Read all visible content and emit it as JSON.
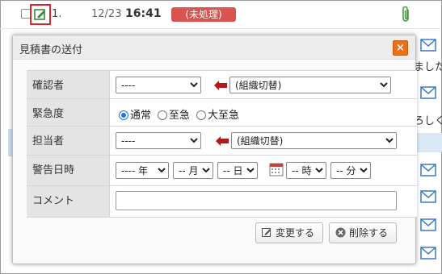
{
  "list_row": {
    "number": "1.",
    "date": "12/23",
    "time": "16:41",
    "status_badge": "(未処理)"
  },
  "side_texts": [
    "ました",
    "ろしく"
  ],
  "dialog": {
    "title": "見積書の送付",
    "close_label": "×",
    "rows": {
      "confirmer": {
        "label": "確認者",
        "user_value": "----",
        "org_value": "(組織切替)"
      },
      "urgency": {
        "label": "緊急度",
        "options": [
          "通常",
          "至急",
          "大至急"
        ],
        "selected": "通常"
      },
      "assignee": {
        "label": "担当者",
        "user_value": "----",
        "org_value": "(組織切替)"
      },
      "alert_date": {
        "label": "警告日時",
        "year": "---- 年",
        "month": "-- 月",
        "day": "-- 日",
        "hour": "-- 時",
        "minute": "-- 分"
      },
      "comment": {
        "label": "コメント",
        "value": ""
      }
    },
    "buttons": {
      "change": "変更する",
      "delete": "削除する"
    }
  },
  "colors": {
    "badge": "#d9534f",
    "close": "#e8711a",
    "highlight_border": "#e0242e",
    "arrow": "#b11818",
    "radio": "#1a73e8"
  }
}
